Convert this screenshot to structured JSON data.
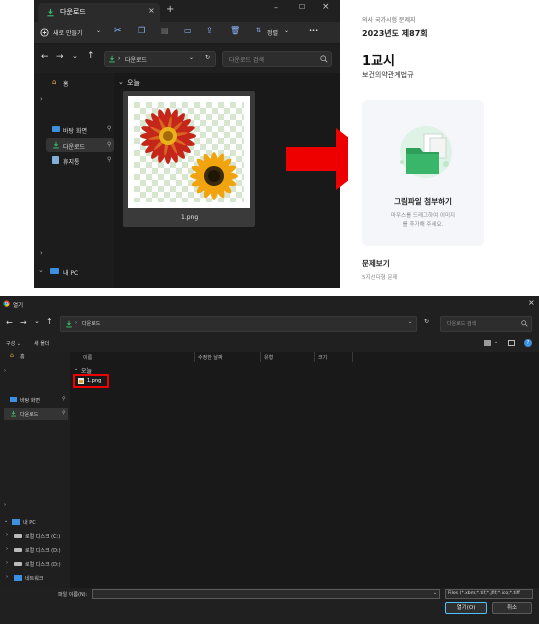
{
  "explorer": {
    "tab_title": "다운로드",
    "new_button": "새로 만들기",
    "sort_button": "정렬",
    "more_button": "···",
    "address_crumb": "다운로드",
    "search_placeholder": "다운로드 검색",
    "group_today": "오늘",
    "sidebar": [
      {
        "label": "홈",
        "icon": "home-icon"
      },
      {
        "label": "바탕 화면",
        "icon": "desktop-icon"
      },
      {
        "label": "다운로드",
        "icon": "download-icon"
      },
      {
        "label": "휴지통",
        "icon": "recycle-bin-icon"
      },
      {
        "label": "내 PC",
        "icon": "pc-icon"
      }
    ],
    "file": {
      "name": "1.png"
    }
  },
  "web": {
    "exam_series": "의사 국가시험 문제지",
    "year_round": "2023년도 제87회",
    "session": "1교시",
    "subject": "보건의약관계법규",
    "upload_title": "그림파일 첨부하기",
    "upload_desc_line1": "마우스를 드래그하여 이미지",
    "upload_desc_line2": "를 추가해 주세요.",
    "section_title": "문제보기",
    "section_sub": "5지선다형 문제"
  },
  "dialog": {
    "title": "열기",
    "address_crumb": "다운로드",
    "search_placeholder": "다운로드 검색",
    "organize": "구성",
    "new_folder": "새 폴더",
    "columns": [
      "이름",
      "수정한 날짜",
      "유형",
      "크기"
    ],
    "group_today": "오늘",
    "file_name": "1.png",
    "sidebar": [
      {
        "label": "홈",
        "icon": "home-icon"
      },
      {
        "label": "바탕 화면",
        "icon": "desktop-icon"
      },
      {
        "label": "다운로드",
        "icon": "download-icon"
      },
      {
        "label": "내 PC",
        "icon": "pc-icon"
      },
      {
        "label": "로컬 디스크 (C:)",
        "icon": "drive-icon"
      },
      {
        "label": "로컬 디스크 (D:)",
        "icon": "drive-icon"
      },
      {
        "label": "로컬 디스크 (D:)",
        "icon": "drive-icon"
      },
      {
        "label": "네트워크",
        "icon": "network-icon"
      }
    ],
    "filename_label": "파일 이름(N):",
    "filetype_value": "Files (*.xbm;*.tif;*.jfif;*.ico;*.tiff",
    "open_button": "열기(O)",
    "cancel_button": "취소"
  },
  "colors": {
    "arrow_red": "#ee0000",
    "highlight_red": "#ee0000",
    "accent_blue": "#4cc2ff",
    "download_green": "#3ab66a"
  }
}
